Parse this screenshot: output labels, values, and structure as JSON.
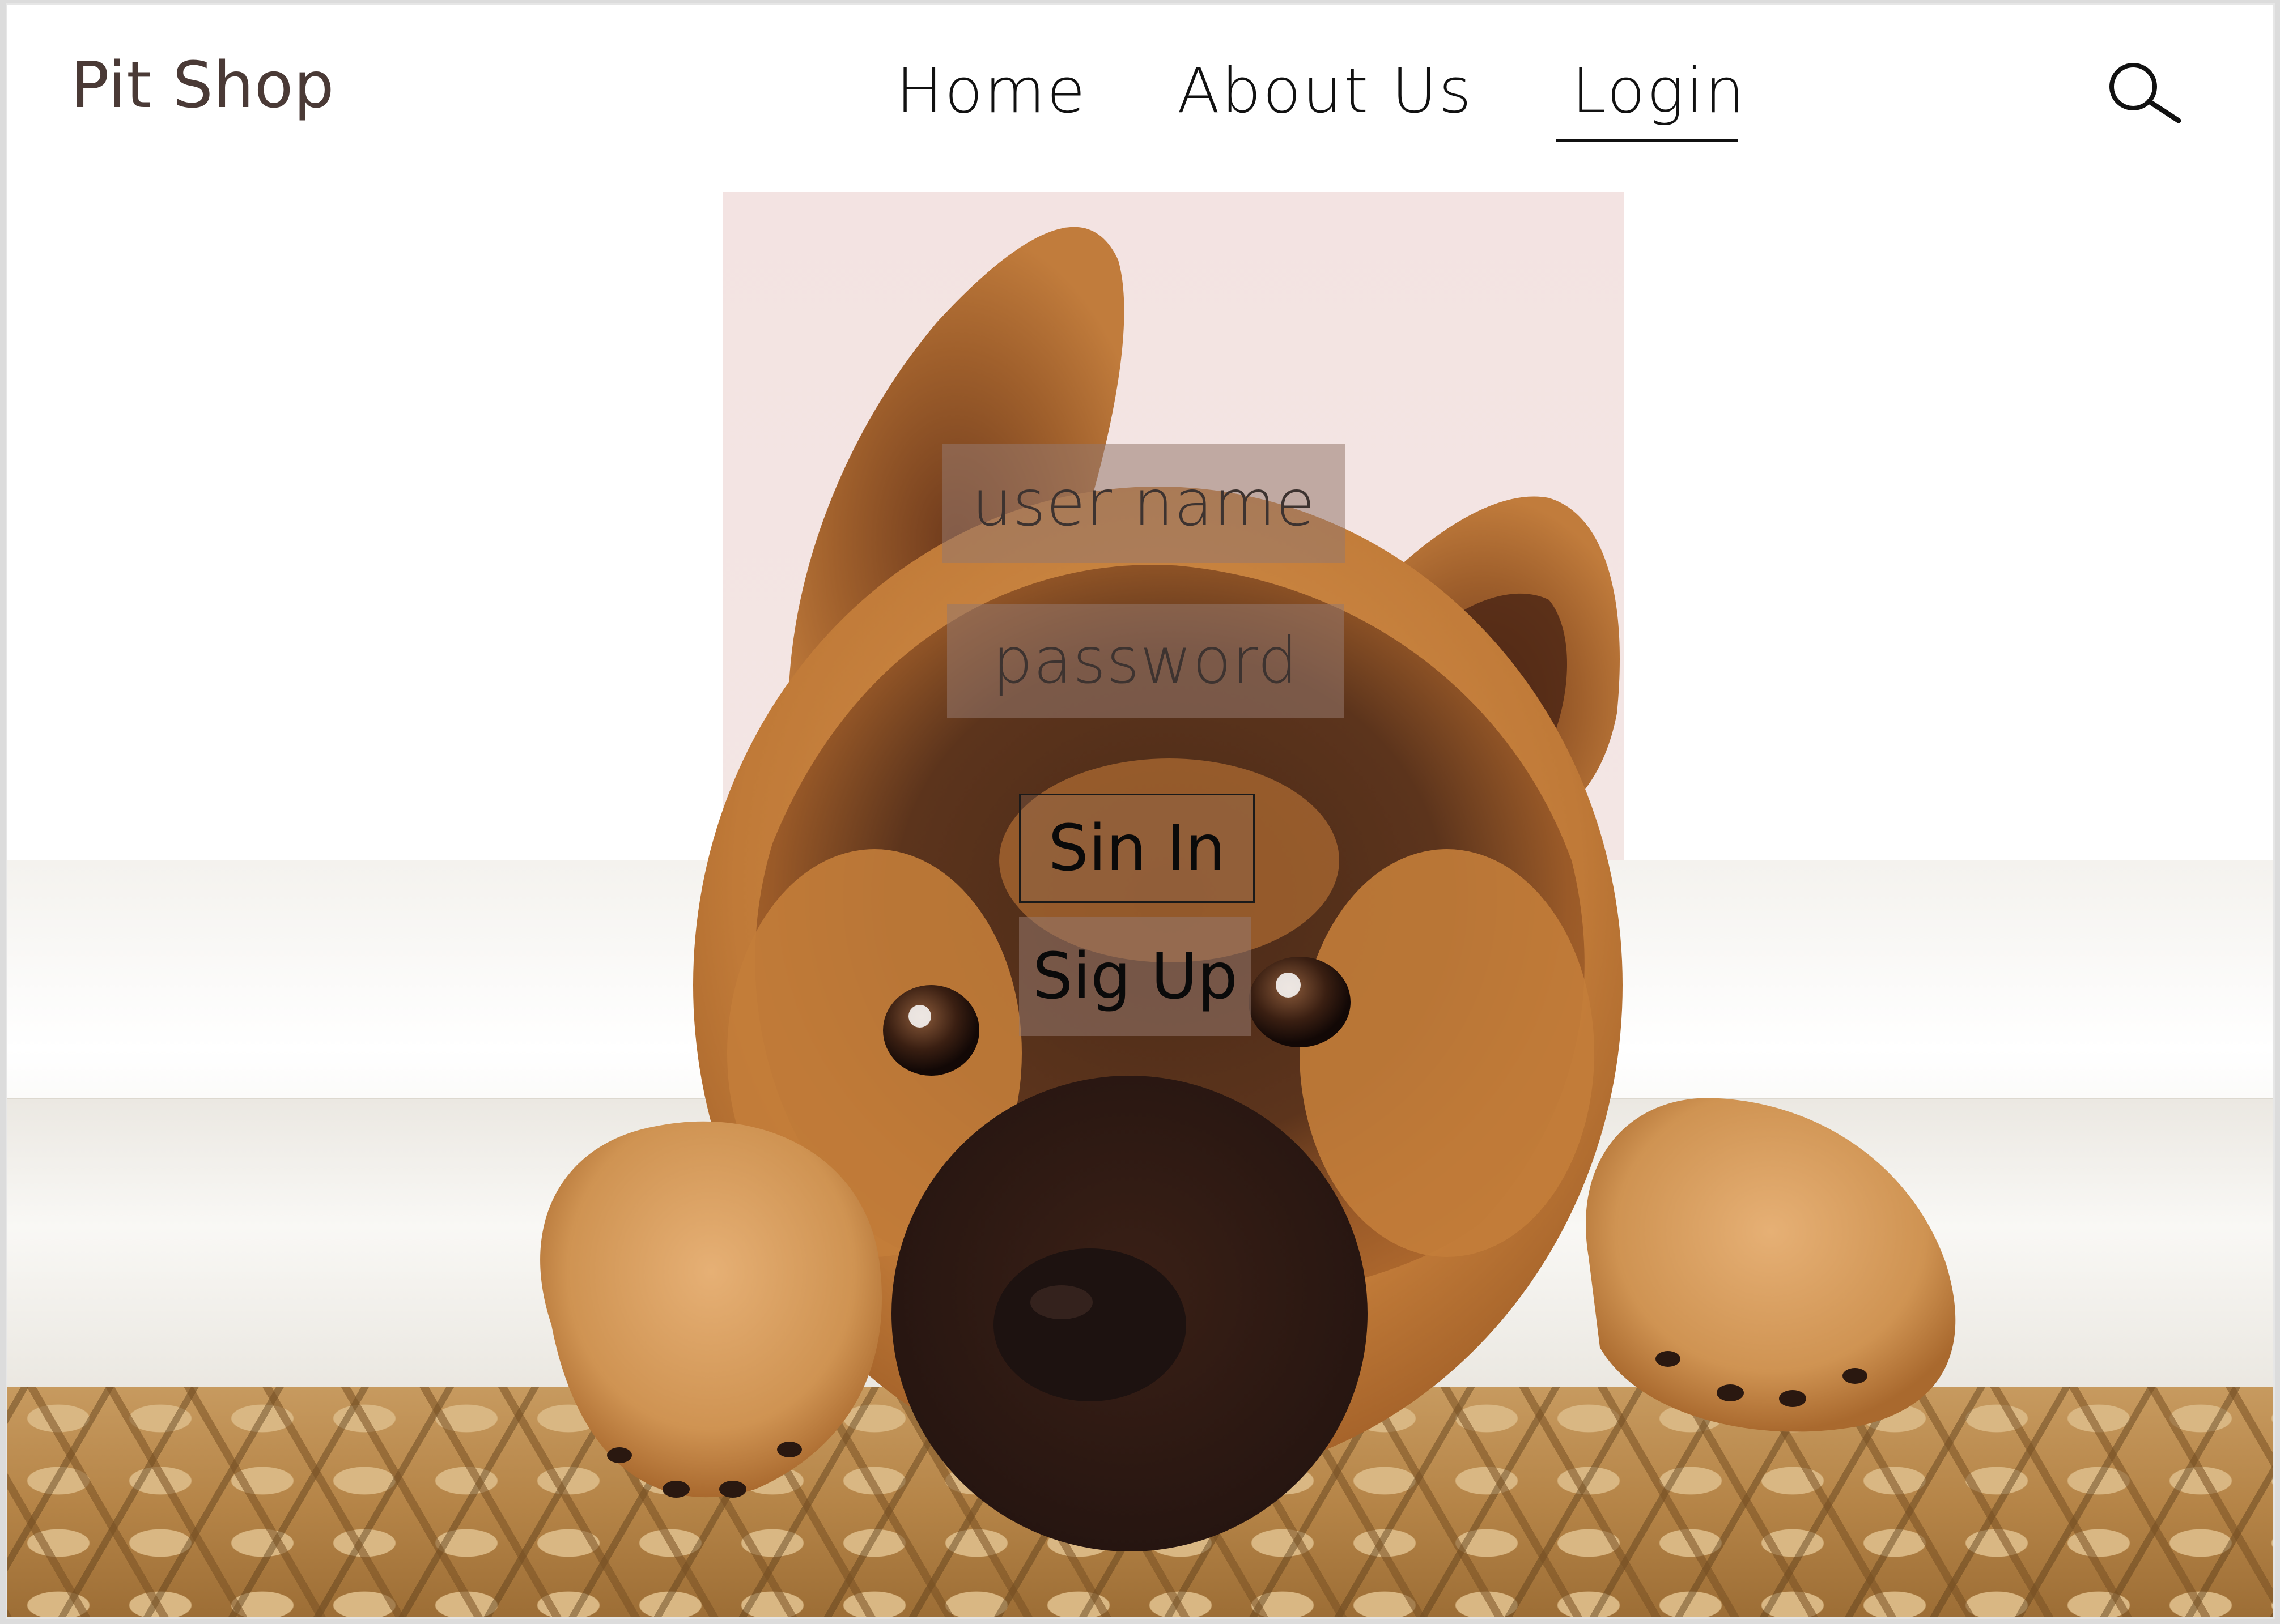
{
  "header": {
    "brand": "Pit Shop",
    "nav": [
      {
        "label": "Home"
      },
      {
        "label": "About Us"
      },
      {
        "label": "Login",
        "active": true
      }
    ],
    "search_icon": "search-icon"
  },
  "hero": {
    "image_subject": "german-shepherd-puppy-in-basket"
  },
  "login_form": {
    "username_placeholder": "user name",
    "password_placeholder": "password",
    "signin_label": "Sin In",
    "signup_label": "Sig Up"
  },
  "colors": {
    "brand_text": "#4a3a36",
    "nav_text": "#111111",
    "field_bg": "rgba(150,120,110,0.55)",
    "background": "#ffffff"
  }
}
